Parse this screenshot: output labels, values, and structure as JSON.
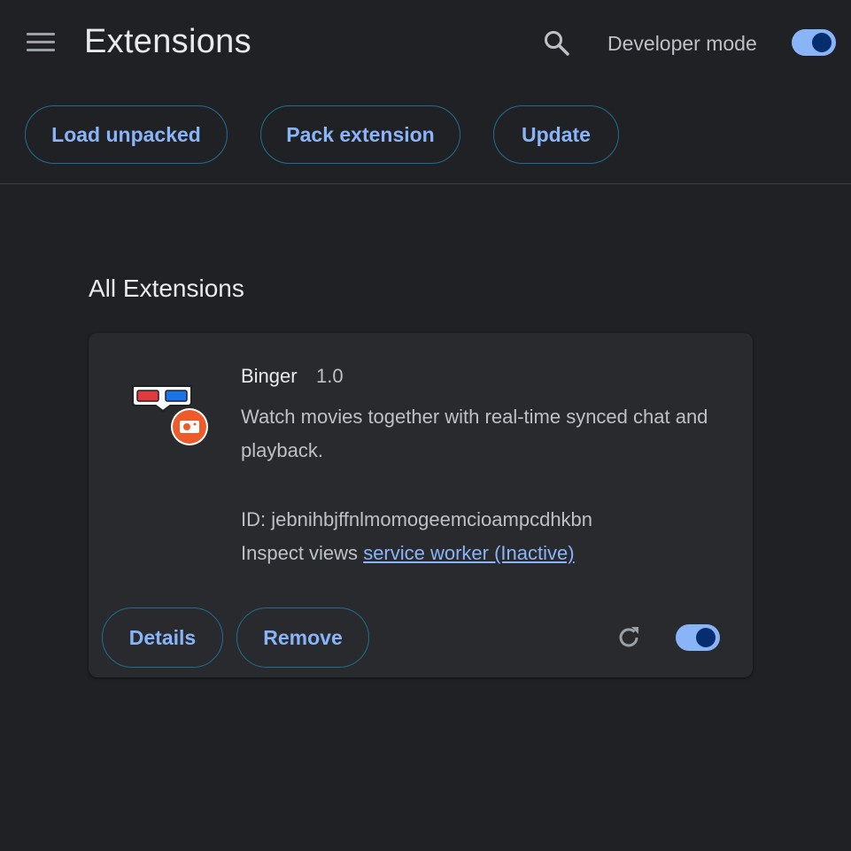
{
  "header": {
    "title": "Extensions",
    "developer_mode_label": "Developer mode",
    "developer_mode_on": true
  },
  "toolbar": {
    "load_unpacked": "Load unpacked",
    "pack_extension": "Pack extension",
    "update": "Update"
  },
  "section": {
    "title": "All Extensions"
  },
  "extension": {
    "name": "Binger",
    "version": "1.0",
    "description": "Watch movies together with real-time synced chat and playback.",
    "id_text": "ID: jebnihbjffnlmomogeemcioampcdhkbn",
    "inspect_label": "Inspect views",
    "inspect_link": "service worker (Inactive)",
    "details_label": "Details",
    "remove_label": "Remove",
    "enabled": true
  },
  "colors": {
    "background": "#202124",
    "card": "#292a2d",
    "accent": "#8ab4f8",
    "button_border": "#1f6f93"
  },
  "icons": [
    "menu-icon",
    "search-icon",
    "extension-icon",
    "reload-icon"
  ]
}
